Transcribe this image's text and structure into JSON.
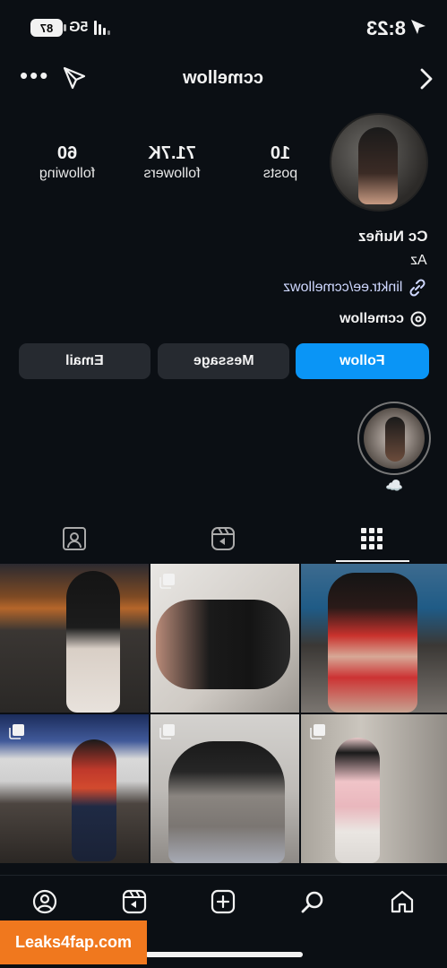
{
  "status_bar": {
    "time": "8:23",
    "network": "5G",
    "battery": "87"
  },
  "header": {
    "username": "ccmellow"
  },
  "profile": {
    "stats": [
      {
        "value": "10",
        "label": "posts"
      },
      {
        "value": "71.7K",
        "label": "followers"
      },
      {
        "value": "60",
        "label": "following"
      }
    ],
    "display_name": "Cc Nuñez",
    "bio": "Az",
    "link": "linktr.ee/ccmellowz",
    "threads_handle": "ccmellow"
  },
  "actions": {
    "follow": "Follow",
    "message": "Message",
    "email": "Email"
  },
  "highlight": {
    "label": "☁️"
  },
  "tabs": [
    "posts-grid",
    "reels",
    "tagged"
  ],
  "grid": [
    {
      "icon": "multi-photo-icon",
      "multi": false
    },
    {
      "icon": "multi-photo-icon",
      "multi": true
    },
    {
      "icon": "multi-photo-icon",
      "multi": false
    },
    {
      "icon": "multi-photo-icon",
      "multi": true
    },
    {
      "icon": "multi-photo-icon",
      "multi": true
    },
    {
      "icon": "multi-photo-icon",
      "multi": true
    }
  ],
  "bottom_nav": [
    "home",
    "search",
    "create",
    "reels",
    "profile"
  ],
  "watermark": "Leaks4fap.com",
  "colors": {
    "background": "#0b0f14",
    "accent": "#0a95f6",
    "button": "#262a30"
  }
}
